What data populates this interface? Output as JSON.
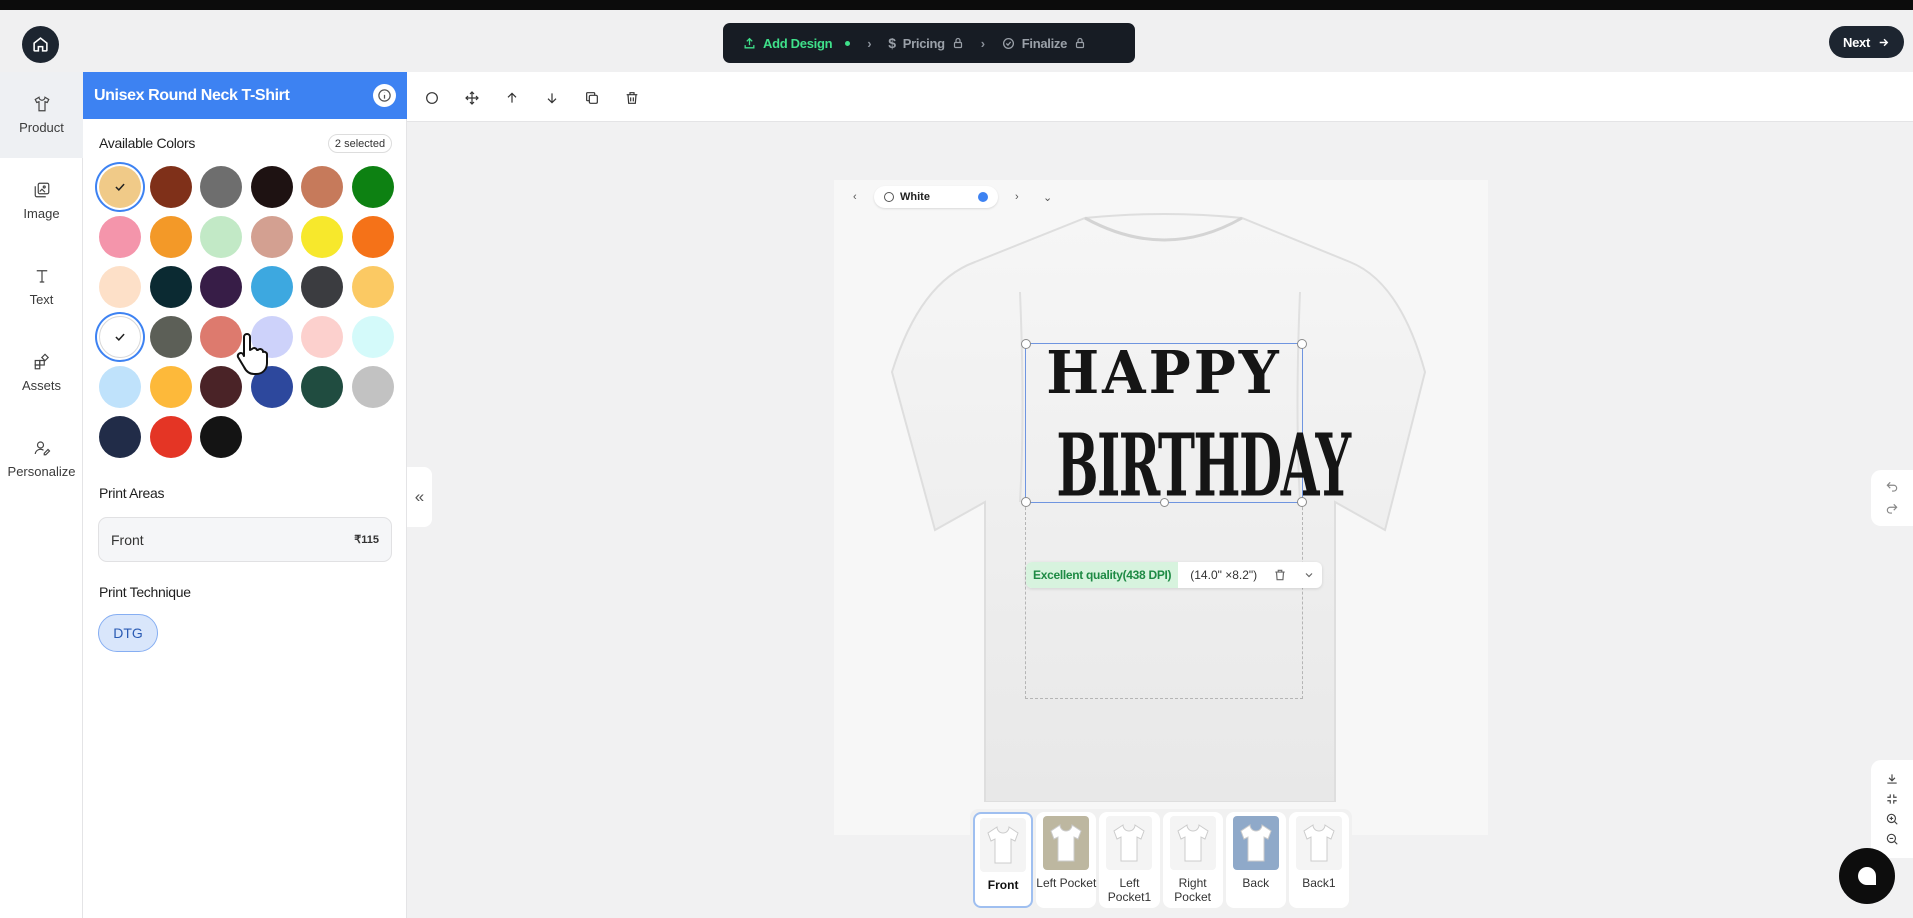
{
  "stepper": {
    "steps": [
      {
        "label": "Add Design",
        "state": "active"
      },
      {
        "label": "Pricing",
        "state": "locked"
      },
      {
        "label": "Finalize",
        "state": "locked"
      }
    ]
  },
  "next_label": "Next",
  "rail": {
    "items": [
      {
        "label": "Product",
        "icon": "tshirt-icon",
        "active": true
      },
      {
        "label": "Image",
        "icon": "image-icon"
      },
      {
        "label": "Text",
        "icon": "text-icon"
      },
      {
        "label": "Assets",
        "icon": "assets-icon"
      },
      {
        "label": "Personalize",
        "icon": "personalize-icon"
      }
    ]
  },
  "panel": {
    "title": "Unisex Round Neck T-Shirt",
    "colors_label": "Available Colors",
    "selected_badge": "2 selected",
    "colors": [
      {
        "hex": "#f0ca88",
        "selected": true
      },
      {
        "hex": "#7f3019"
      },
      {
        "hex": "#6e6e6e"
      },
      {
        "hex": "#1e1212"
      },
      {
        "hex": "#c67a5b"
      },
      {
        "hex": "#0d8112"
      },
      {
        "hex": "#f495ab"
      },
      {
        "hex": "#f39928"
      },
      {
        "hex": "#c2e9c6"
      },
      {
        "hex": "#d3a091"
      },
      {
        "hex": "#f7e82c"
      },
      {
        "hex": "#f57218"
      },
      {
        "hex": "#fde0c8"
      },
      {
        "hex": "#0b2a32"
      },
      {
        "hex": "#371d47"
      },
      {
        "hex": "#3da8e0"
      },
      {
        "hex": "#3b3c40"
      },
      {
        "hex": "#fbc963"
      },
      {
        "hex": "#ffffff",
        "selected": true
      },
      {
        "hex": "#5c5f57"
      },
      {
        "hex": "#dd7a6e"
      },
      {
        "hex": "#cdd2fa"
      },
      {
        "hex": "#fcd0cd"
      },
      {
        "hex": "#d4fafa"
      },
      {
        "hex": "#bfe2fb"
      },
      {
        "hex": "#fdb93a"
      },
      {
        "hex": "#4a2327"
      },
      {
        "hex": "#2d489d"
      },
      {
        "hex": "#204c40"
      },
      {
        "hex": "#c2c2c2"
      },
      {
        "hex": "#212c48"
      },
      {
        "hex": "#e43525"
      },
      {
        "hex": "#141414"
      }
    ],
    "print_areas_label": "Print Areas",
    "print_area": {
      "name": "Front",
      "price": "₹115"
    },
    "technique_label": "Print Technique",
    "technique": "DTG"
  },
  "canvas": {
    "selected_color": "White",
    "design_text": [
      "HAPPY",
      "BIRTHDAY"
    ],
    "quality": "Excellent quality(438 DPI)",
    "dimensions": "(14.0\" ×8.2\")"
  },
  "views": [
    {
      "label": "Front",
      "active": true
    },
    {
      "label": "Left Pocket"
    },
    {
      "label": "Left Pocket1"
    },
    {
      "label": "Right Pocket"
    },
    {
      "label": "Back"
    },
    {
      "label": "Back1"
    }
  ]
}
